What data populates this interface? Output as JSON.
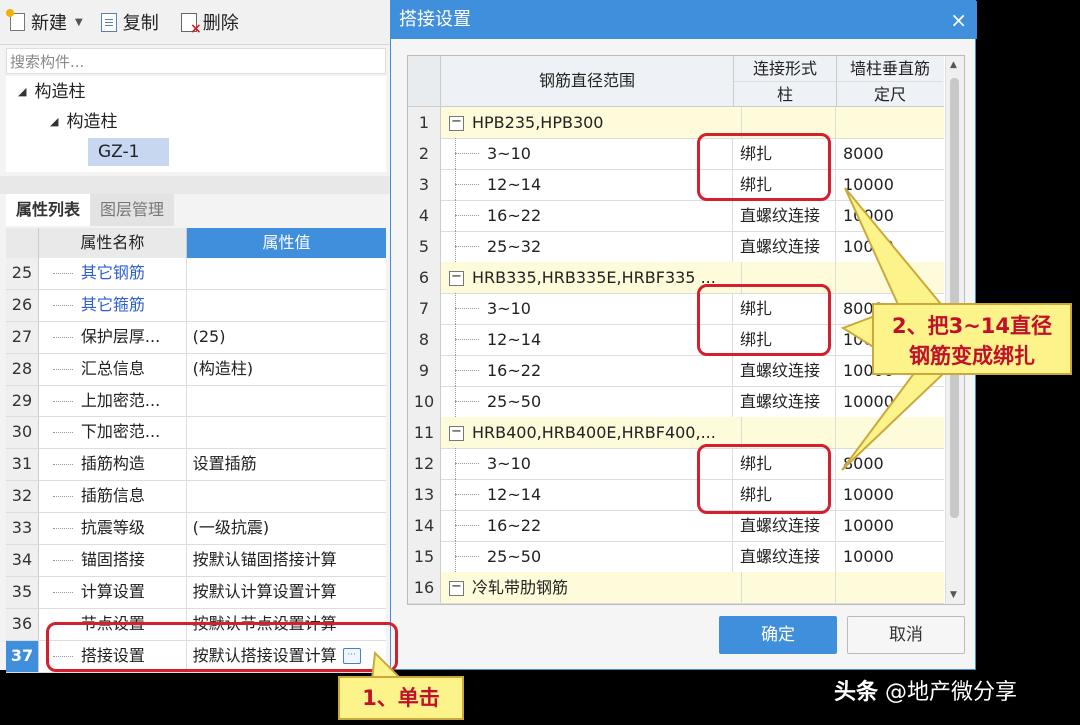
{
  "toolbar": {
    "new_label": "新建",
    "copy_label": "复制",
    "delete_label": "删除"
  },
  "search": {
    "placeholder": "搜索构件..."
  },
  "tree": {
    "root": "构造柱",
    "child": "构造柱",
    "leaf": "GZ-1"
  },
  "tabs": {
    "props": "属性列表",
    "layers": "图层管理"
  },
  "prop_table": {
    "col_name": "属性名称",
    "col_value": "属性值",
    "rows": [
      {
        "num": "25",
        "name": "其它钢筋",
        "value": "",
        "blue": true
      },
      {
        "num": "26",
        "name": "其它箍筋",
        "value": "",
        "blue": true
      },
      {
        "num": "27",
        "name": "保护层厚...",
        "value": "(25)"
      },
      {
        "num": "28",
        "name": "汇总信息",
        "value": "(构造柱)"
      },
      {
        "num": "29",
        "name": "上加密范...",
        "value": ""
      },
      {
        "num": "30",
        "name": "下加密范...",
        "value": ""
      },
      {
        "num": "31",
        "name": "插筋构造",
        "value": "设置插筋"
      },
      {
        "num": "32",
        "name": "插筋信息",
        "value": ""
      },
      {
        "num": "33",
        "name": "抗震等级",
        "value": "(一级抗震)"
      },
      {
        "num": "34",
        "name": "锚固搭接",
        "value": "按默认锚固搭接计算"
      },
      {
        "num": "35",
        "name": "计算设置",
        "value": "按默认计算设置计算"
      },
      {
        "num": "36",
        "name": "节点设置",
        "value": "按默认节点设置计算"
      },
      {
        "num": "37",
        "name": "搭接设置",
        "value": "按默认搭接设置计算",
        "selected": true
      }
    ]
  },
  "dialog": {
    "title": "搭接设置",
    "close": "×",
    "col_range": "钢筋直径范围",
    "col_conn_top": "连接形式",
    "col_conn_sub": "柱",
    "col_fix_top": "墙柱垂直筋",
    "col_fix_sub": "定尺",
    "rows": [
      {
        "num": "1",
        "range": "HPB235,HPB300",
        "conn": "",
        "fix": "",
        "group": true
      },
      {
        "num": "2",
        "range": "3~10",
        "conn": "绑扎",
        "fix": "8000"
      },
      {
        "num": "3",
        "range": "12~14",
        "conn": "绑扎",
        "fix": "10000"
      },
      {
        "num": "4",
        "range": "16~22",
        "conn": "直螺纹连接",
        "fix": "10000"
      },
      {
        "num": "5",
        "range": "25~32",
        "conn": "直螺纹连接",
        "fix": "10000"
      },
      {
        "num": "6",
        "range": "HRB335,HRB335E,HRBF335 ...",
        "conn": "",
        "fix": "",
        "group": true
      },
      {
        "num": "7",
        "range": "3~10",
        "conn": "绑扎",
        "fix": "8000"
      },
      {
        "num": "8",
        "range": "12~14",
        "conn": "绑扎",
        "fix": "10000"
      },
      {
        "num": "9",
        "range": "16~22",
        "conn": "直螺纹连接",
        "fix": "10000"
      },
      {
        "num": "10",
        "range": "25~50",
        "conn": "直螺纹连接",
        "fix": "10000"
      },
      {
        "num": "11",
        "range": "HRB400,HRB400E,HRBF400,...",
        "conn": "",
        "fix": "",
        "group": true
      },
      {
        "num": "12",
        "range": "3~10",
        "conn": "绑扎",
        "fix": "8000"
      },
      {
        "num": "13",
        "range": "12~14",
        "conn": "绑扎",
        "fix": "10000"
      },
      {
        "num": "14",
        "range": "16~22",
        "conn": "直螺纹连接",
        "fix": "10000"
      },
      {
        "num": "15",
        "range": "25~50",
        "conn": "直螺纹连接",
        "fix": "10000"
      },
      {
        "num": "16",
        "range": "冷轧带肋钢筋",
        "conn": "",
        "fix": "",
        "group": true
      }
    ],
    "ok_label": "确定",
    "cancel_label": "取消"
  },
  "annotations": {
    "callout1": "1、单击",
    "callout2_line1": "2、把3~14直径",
    "callout2_line2": "钢筋变成绑扎",
    "watermark_brand": "头条",
    "watermark_handle": "@地产微分享"
  },
  "colors": {
    "accent": "#3f8fdd",
    "annotation_red": "#d41f2f",
    "callout_yellow": "#fdf38b",
    "group_row": "#fdfbd9"
  }
}
